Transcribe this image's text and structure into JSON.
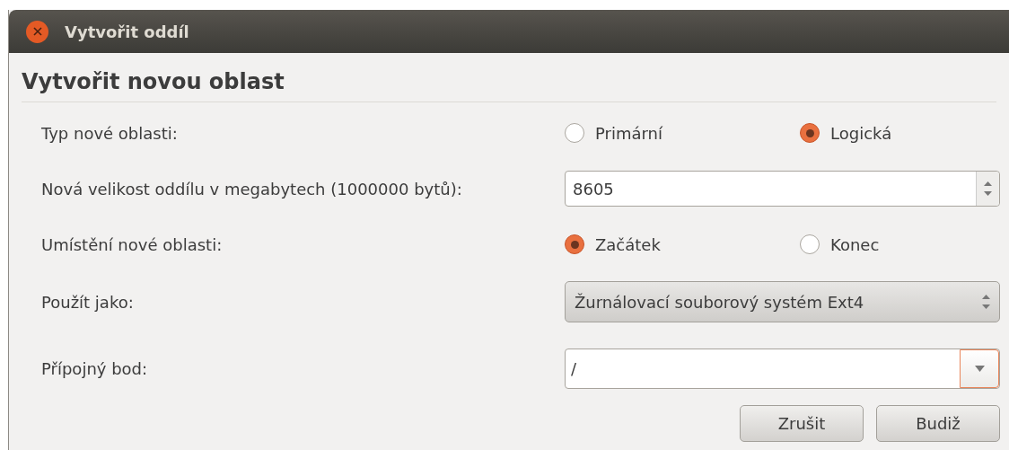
{
  "window": {
    "title": "Vytvořit oddíl"
  },
  "heading": "Vytvořit novou oblast",
  "rows": [
    {
      "kind": "radio",
      "label": "Typ nové oblasti:",
      "options": [
        {
          "label": "Primární",
          "selected": false
        },
        {
          "label": "Logická",
          "selected": true
        }
      ]
    },
    {
      "kind": "spin",
      "label": "Nová velikost oddílu v megabytech (1000000 bytů):",
      "value": "8605"
    },
    {
      "kind": "radio",
      "label": "Umístění nové oblasti:",
      "options": [
        {
          "label": "Začátek",
          "selected": true
        },
        {
          "label": "Konec",
          "selected": false
        }
      ]
    },
    {
      "kind": "combo",
      "label": "Použít jako:",
      "value": "Žurnálovací souborový systém Ext4"
    },
    {
      "kind": "entry",
      "label": "Přípojný bod:",
      "value": "/"
    }
  ],
  "buttons": [
    "Zrušit",
    "Budiž"
  ]
}
